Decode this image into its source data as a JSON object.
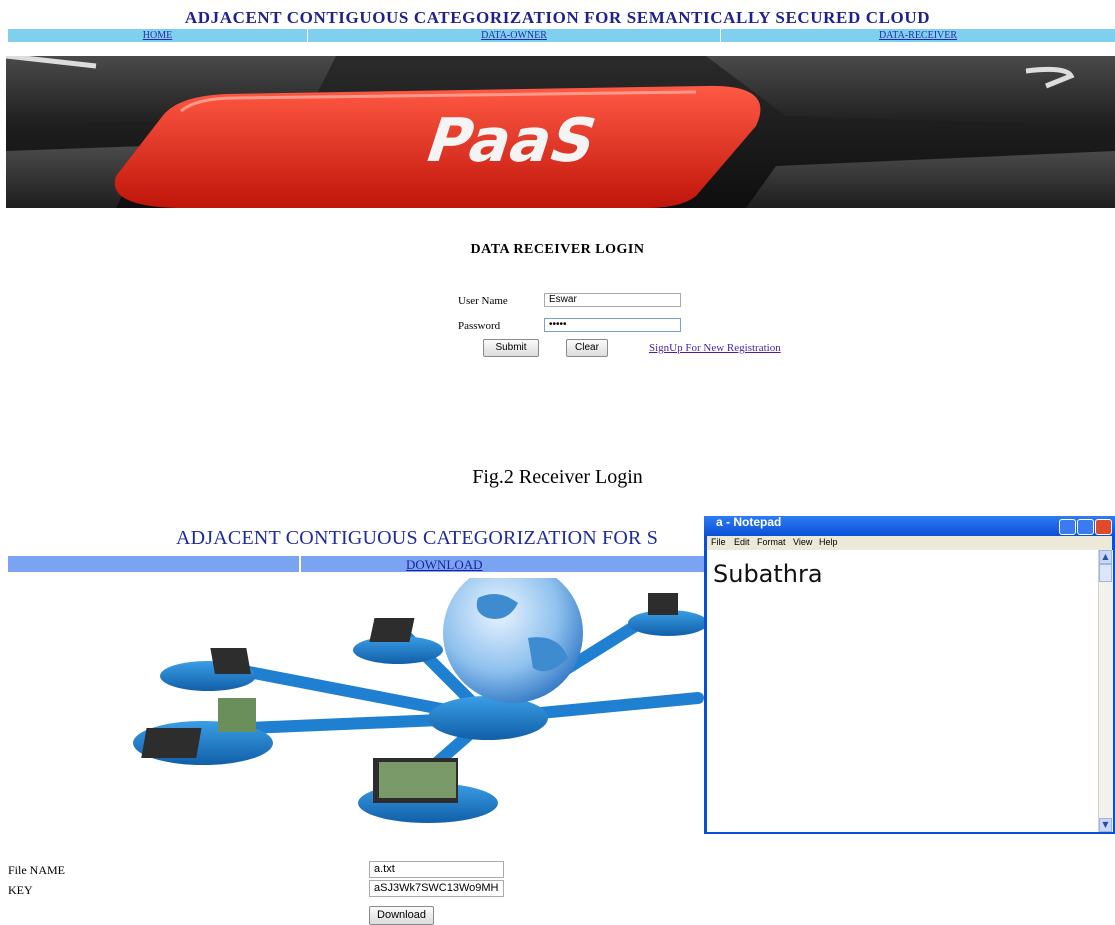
{
  "screen1": {
    "title": "ADJACENT CONTIGUOUS CATEGORIZATION FOR SEMANTICALLY SECURED CLOUD",
    "nav": [
      {
        "label": "HOME"
      },
      {
        "label": "DATA-OWNER"
      },
      {
        "label": "DATA-RECEIVER"
      }
    ],
    "hero_key_text": "PaaS",
    "login": {
      "heading": "DATA RECEIVER LOGIN",
      "username_label": "User Name",
      "username_value": "Eswar",
      "password_label": "Password",
      "password_value": "•••••",
      "submit_label": "Submit",
      "clear_label": "Clear",
      "signup_link": "SignUp For New Registration"
    }
  },
  "caption": "Fig.2 Receiver Login",
  "screen2": {
    "title": "ADJACENT CONTIGUOUS CATEGORIZATION FOR S",
    "nav_link": "DOWNLOAD",
    "file_name_label": "File NAME",
    "file_name_value": "a.txt",
    "key_label": "KEY",
    "key_value": "aSJ3Wk7SWC13Wo9MH",
    "download_label": "Download"
  },
  "notepad": {
    "window_title": "a - Notepad",
    "menu": [
      "File",
      "Edit",
      "Format",
      "View",
      "Help"
    ],
    "content": "Subathra"
  },
  "colors": {
    "nav1_bg": "#7fd0ef",
    "nav2_bg": "#7aa4f2",
    "title_blue": "#1f1f8f",
    "notepad_frame": "#0a4fd6"
  }
}
